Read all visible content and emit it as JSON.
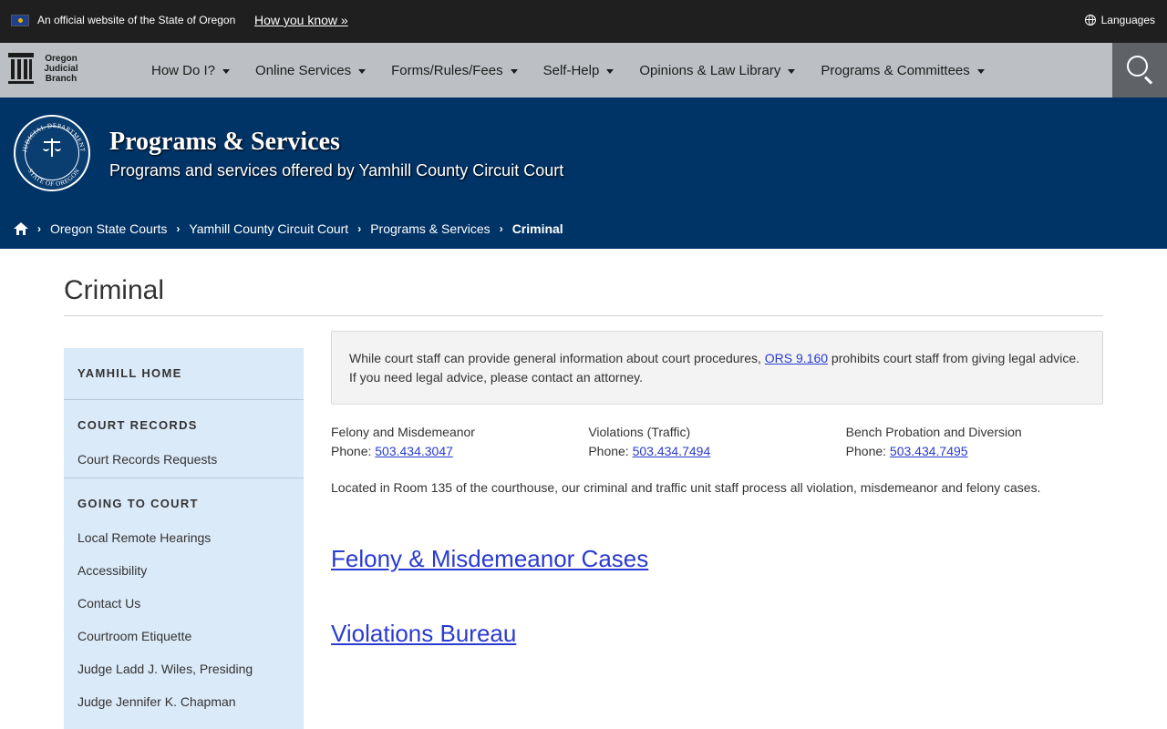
{
  "topbar": {
    "official_text": "An official website of the State of Oregon",
    "how_you_know": "How you know »",
    "languages": "Languages"
  },
  "logo": {
    "line1": "Oregon",
    "line2": "Judicial",
    "line3": "Branch"
  },
  "nav": {
    "items": [
      {
        "label": "How Do I?"
      },
      {
        "label": "Online Services"
      },
      {
        "label": "Forms/Rules/Fees"
      },
      {
        "label": "Self-Help"
      },
      {
        "label": "Opinions & Law Library"
      },
      {
        "label": "Programs & Committees"
      }
    ],
    "search_icon": "search-icon"
  },
  "banner": {
    "title": "Programs & Services",
    "subtitle": "Programs and services offered by Yamhill County Circuit Court",
    "seal_top": "JUDICIAL DEPARTMENT",
    "seal_bottom": "STATE OF OREGON"
  },
  "breadcrumb": {
    "items": [
      "Oregon State Courts",
      "Yamhill County Circuit Court",
      "Programs & Services"
    ],
    "current": "Criminal"
  },
  "page": {
    "title": "Criminal"
  },
  "sidebar": {
    "home": "YAMHILL HOME",
    "court_records": {
      "heading": "COURT RECORDS",
      "links": [
        "Court Records Requests"
      ]
    },
    "going_to_court": {
      "heading": "GOING TO COURT",
      "links": [
        "Local Remote Hearings",
        "Accessibility",
        "Contact Us",
        "Courtroom Etiquette",
        "Judge Ladd J. Wiles, Presiding",
        "Judge Jennifer K. Chapman"
      ]
    }
  },
  "notice": {
    "before": "While court staff can provide general information about court procedures, ",
    "link": "ORS 9.160",
    "after": " prohibits court staff from giving legal advice. If you need legal advice, please contact an attorney."
  },
  "contacts": [
    {
      "label": "Felony and Misdemeanor",
      "phone_label": "Phone: ",
      "phone": "503.434.3047"
    },
    {
      "label": "Violations (Traffic)",
      "phone_label": "Phone: ",
      "phone": "503.434.7494"
    },
    {
      "label": "Bench Probation and Diversion",
      "phone_label": "Phone: ",
      "phone": "503.434.7495"
    }
  ],
  "description": "Located in Room 135 of the courthouse, our criminal and traffic unit staff process all violation, misdemeanor and felony cases.",
  "sections": {
    "felony": "Felony & Misdemeanor Cases",
    "violations": "Violations Bureau"
  },
  "colors": {
    "banner": "#003366",
    "link": "#2a3bd1",
    "sidebar": "#dbeaf9",
    "navbar": "#bcc0c4",
    "topbar": "#1f1f1f"
  }
}
